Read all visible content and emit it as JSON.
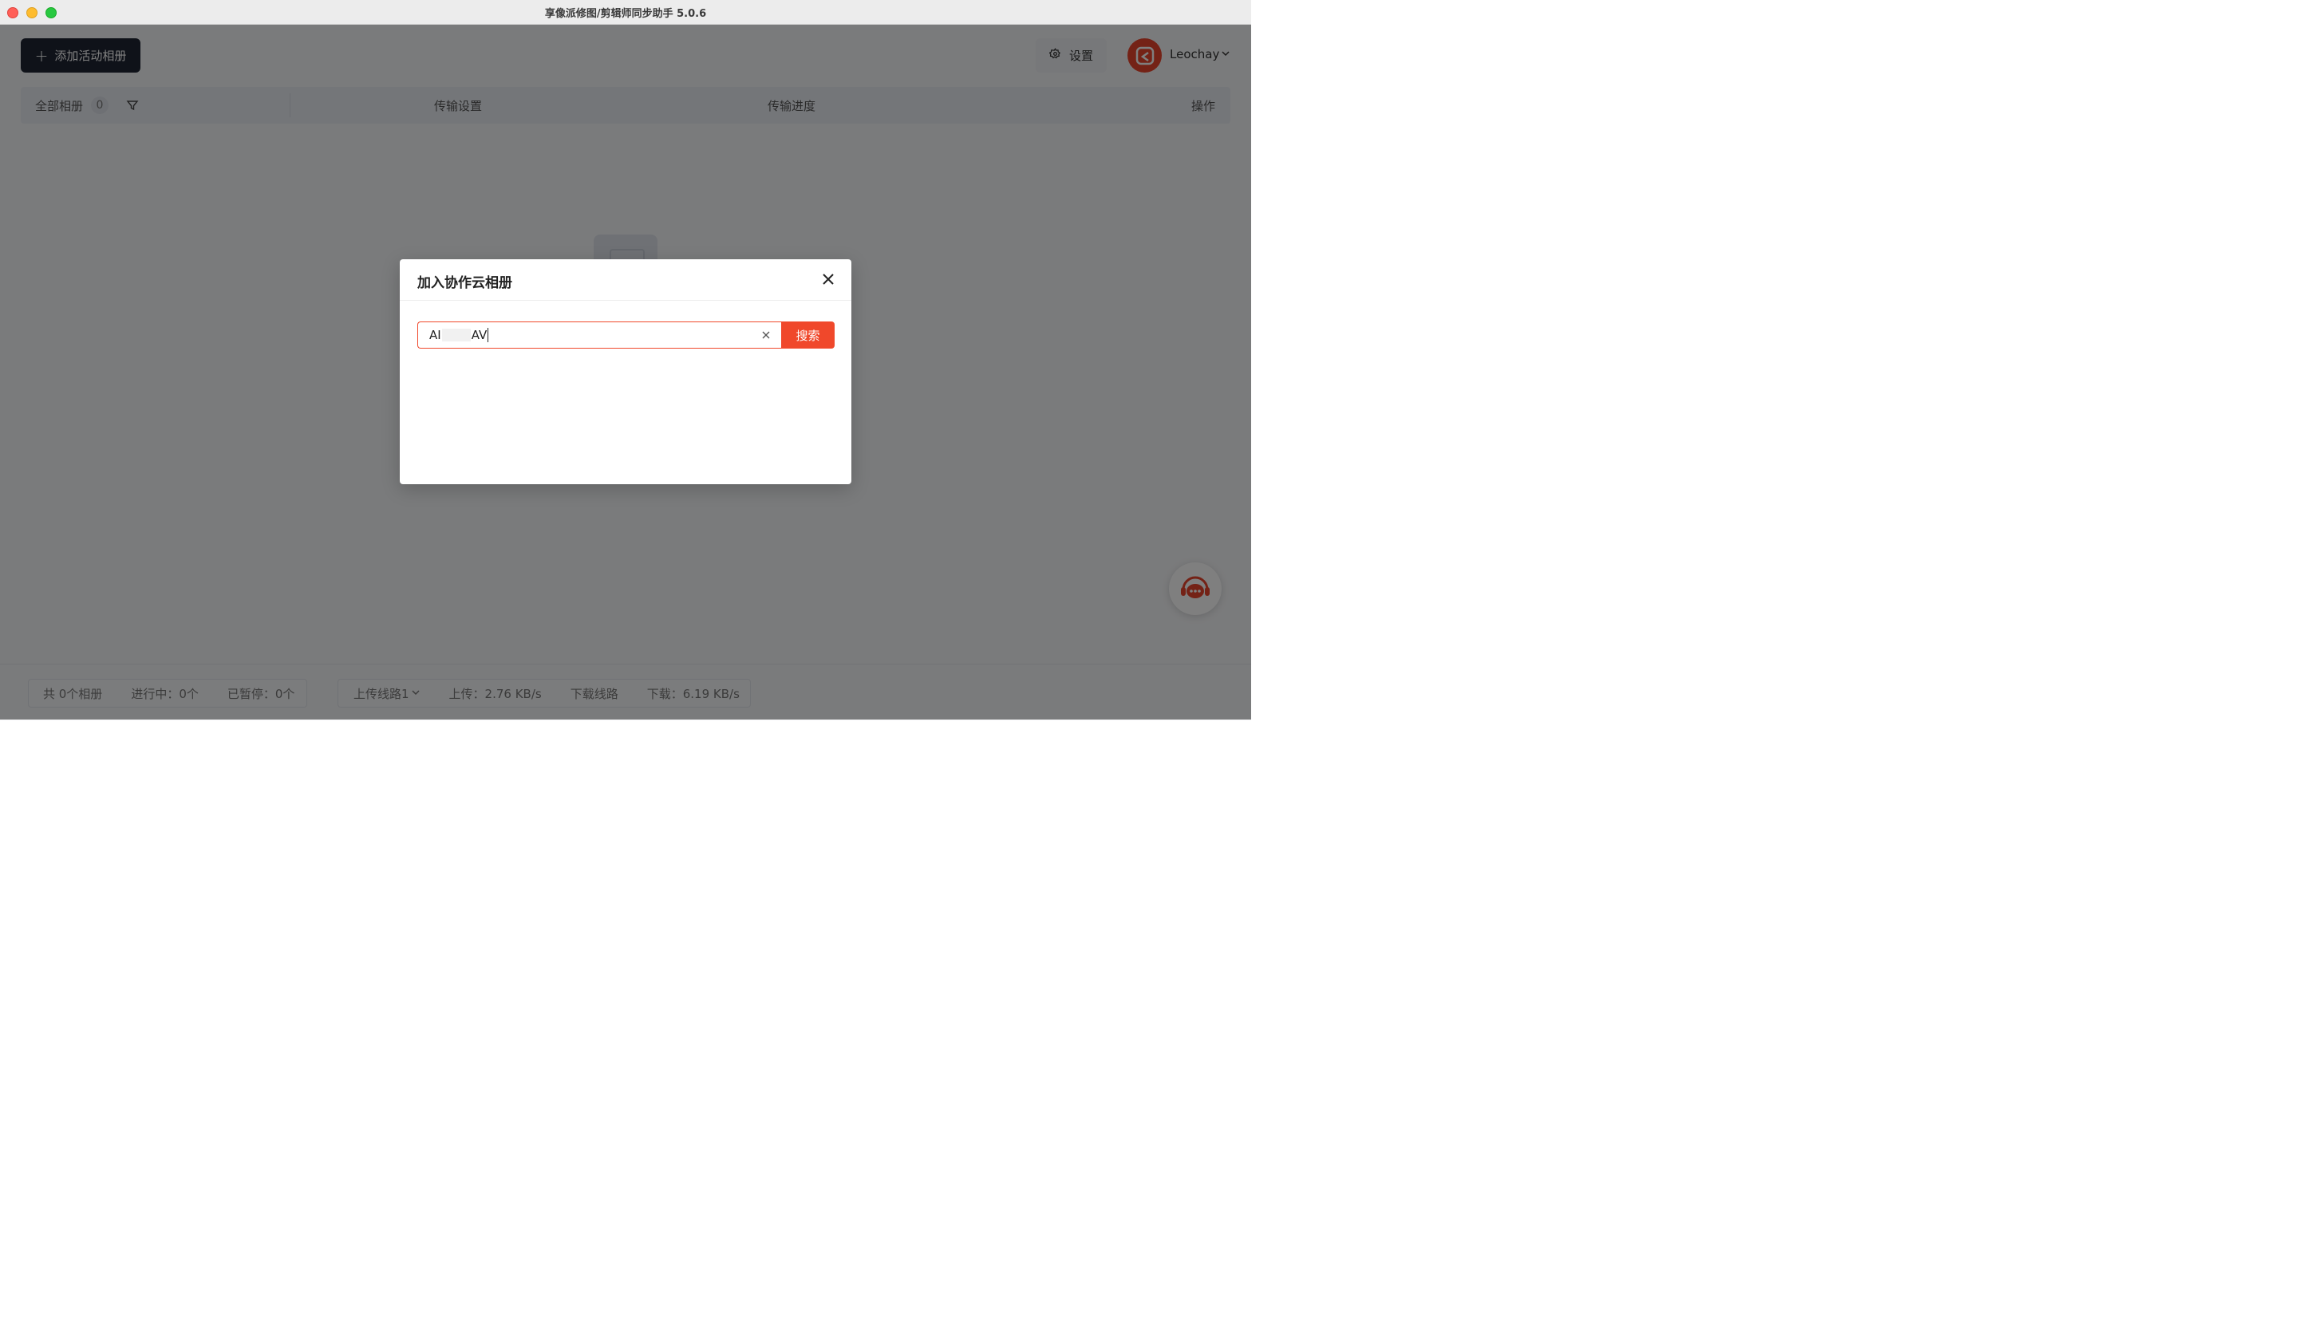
{
  "window": {
    "title": "享像派修图/剪辑师同步助手 5.0.6"
  },
  "toolbar": {
    "add_album_label": "添加活动相册",
    "settings_label": "设置",
    "username": "Leochay"
  },
  "table_header": {
    "all_albums_label": "全部相册",
    "all_albums_count": "0",
    "columns": [
      "传输设置",
      "传输进度",
      "操作"
    ]
  },
  "footer": {
    "total_albums": "共 0个相册",
    "in_progress": "进行中：0个",
    "paused": "已暂停：0个",
    "upload_route": "上传线路1",
    "upload_speed": "上传：2.76 KB/s",
    "download_route": "下载线路",
    "download_speed": "下载：6.19 KB/s"
  },
  "modal": {
    "title": "加入协作云相册",
    "input_prefix": "AI",
    "input_suffix": "AV",
    "search_button_label": "搜索"
  },
  "colors": {
    "accent": "#f0482b",
    "primary_dark": "#1f2533",
    "overlay": "rgba(0,0,0,0.5)"
  },
  "icons": {
    "add": "plus-icon",
    "settings": "gear-icon",
    "filter": "filter-icon",
    "user_menu": "chevron-down-icon",
    "close": "close-icon",
    "clear": "clear-icon",
    "support": "customer-service-icon"
  }
}
